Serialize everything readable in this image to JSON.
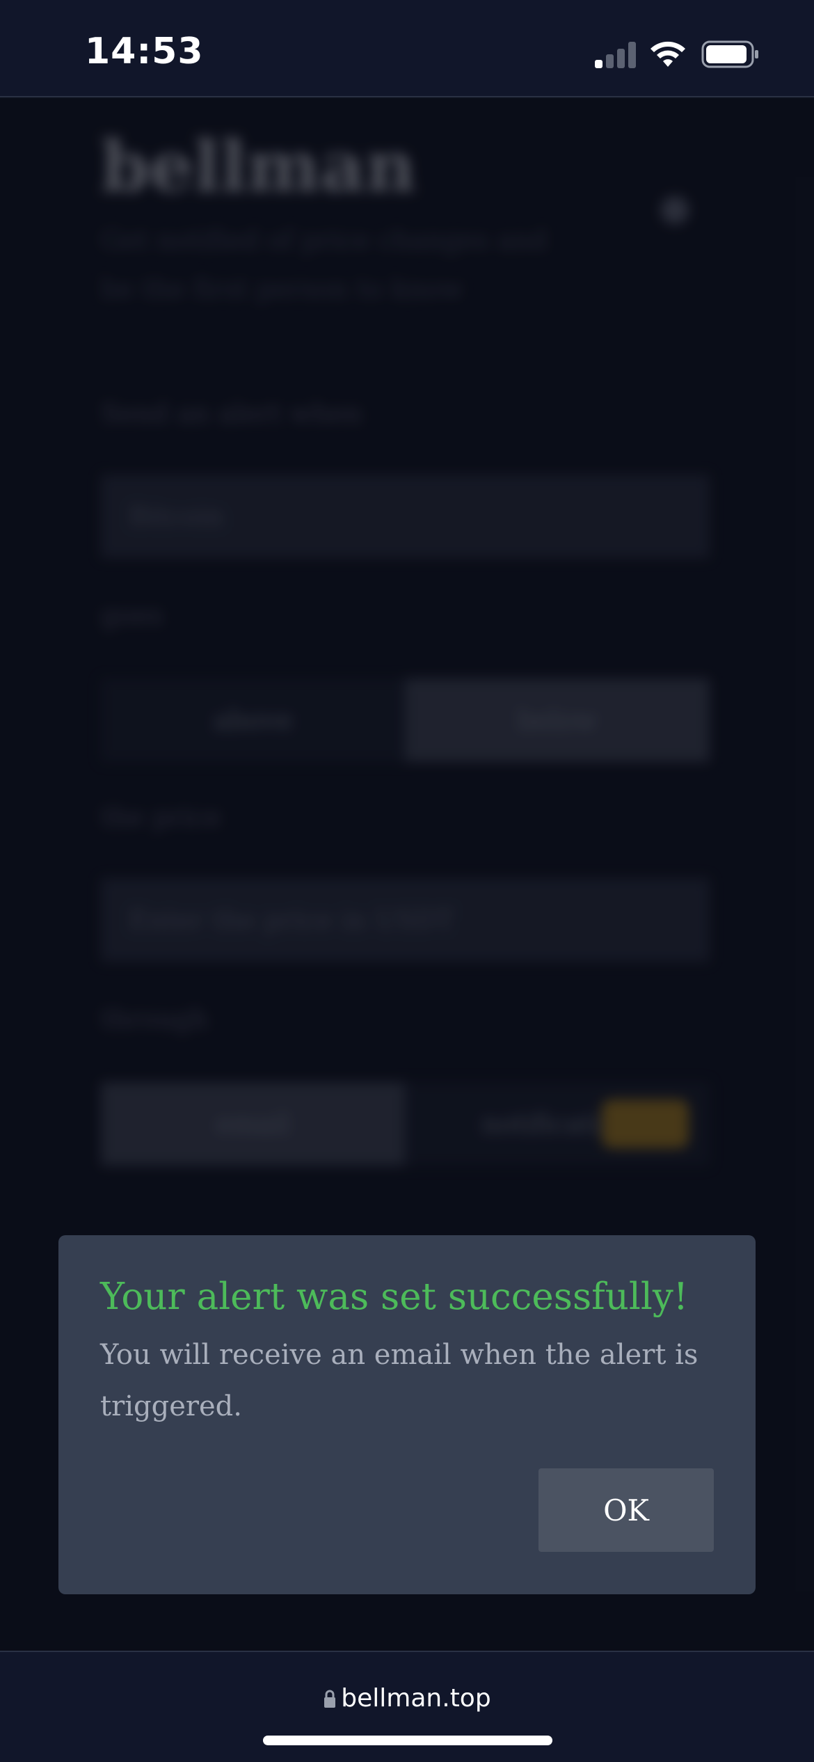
{
  "status_bar": {
    "time": "14:53",
    "icons": [
      "signal-icon",
      "wifi-icon",
      "battery-icon"
    ]
  },
  "background_page": {
    "logo": "bellman",
    "tagline": "Get notified of price changes and be the first person to know",
    "send_alert_label": "Send an alert when",
    "asset_select_value": "Bitcoin",
    "goes_label": "goes",
    "direction_options": [
      "above",
      "below"
    ],
    "direction_selected": "below",
    "price_label": "the price",
    "price_placeholder": "Enter the price in USDT",
    "through_label": "through",
    "channel_options": [
      "email",
      "notifications"
    ],
    "channel_selected": "email"
  },
  "modal": {
    "title": "Your alert was set successfully!",
    "body": "You will receive an email when the alert is triggered.",
    "ok_label": "OK"
  },
  "browser": {
    "url": "bellman.top"
  },
  "colors": {
    "background": "#0c101c",
    "modal_bg": "#363f51",
    "success_green": "#4dbb5a",
    "button_bg": "#4b5362",
    "toggle_accent": "#b88a1c"
  }
}
